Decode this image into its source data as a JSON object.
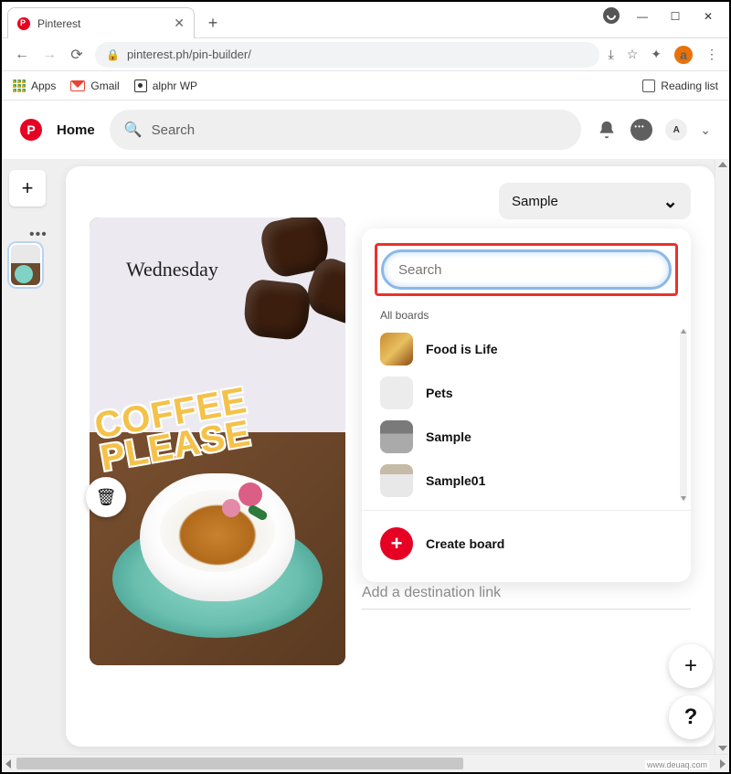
{
  "window": {
    "tab_title": "Pinterest",
    "minimize": "—",
    "maximize": "☐",
    "close": "✕",
    "newtab": "+"
  },
  "chrome": {
    "url": "pinterest.ph/pin-builder/",
    "install_icon": "⤓",
    "star": "☆",
    "ext": "✦",
    "avatar_letter": "a",
    "menu": "⋮"
  },
  "bookmarks": {
    "apps": "Apps",
    "gmail": "Gmail",
    "alphr": "alphr WP",
    "reading": "Reading list"
  },
  "pinterest": {
    "home": "Home",
    "search_placeholder": "Search",
    "avatar_letter": "A",
    "chevron": "⌄"
  },
  "builder": {
    "add": "+",
    "thumb_dots": "•••",
    "trash": "🗑",
    "image_day": "Wednesday",
    "image_text1": "COFFEE",
    "image_text2": "PLEASE",
    "board_selected": "Sample",
    "board_chevron": "⌄"
  },
  "dropdown": {
    "search_placeholder": "Search",
    "label": "All boards",
    "items": [
      {
        "name": "Food is Life"
      },
      {
        "name": "Pets"
      },
      {
        "name": "Sample"
      },
      {
        "name": "Sample01"
      }
    ],
    "create": "Create board",
    "plus": "+"
  },
  "dest_link_placeholder": "Add a destination link",
  "float": {
    "add": "+",
    "help": "?"
  },
  "watermark": "www.deuaq.com"
}
